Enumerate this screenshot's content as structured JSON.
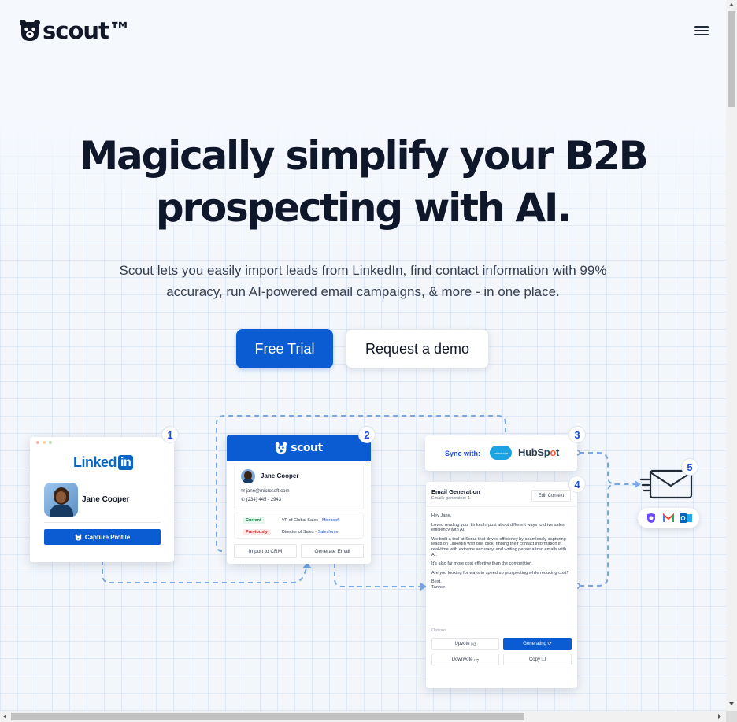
{
  "header": {
    "logo_text": "scout™",
    "logo_icon": "scout-bear-icon",
    "menu_icon": "hamburger-menu-icon"
  },
  "hero": {
    "headline_line1": "Magically simplify your B2B",
    "headline_line2": "prospecting with AI.",
    "subtext_line1": "Scout lets you easily import leads from LinkedIn, find contact information with 99%",
    "subtext_line2": "accuracy, run AI-powered email campaigns, & more - in one place.",
    "primary_cta": "Free Trial",
    "secondary_cta": "Request a demo"
  },
  "colors": {
    "brand_blue": "#0b5bd3",
    "linkedin_blue": "#0a66c2",
    "hubspot_orange": "#ff5c35",
    "salesforce_blue": "#1da1e1"
  },
  "flow": {
    "steps": [
      "1",
      "2",
      "3",
      "4",
      "5"
    ],
    "linkedin_card": {
      "brand_left": "Linked",
      "brand_right": "in",
      "profile_name": "Jane Cooper",
      "capture_button": "Capture Profile"
    },
    "scout_card": {
      "brand": "scout",
      "profile_name": "Jane Cooper",
      "email": "jane@microsoft.com",
      "phone": "(234) 445 - 2943",
      "current_label": "Current",
      "current_role": "VP of Global Sales - ",
      "current_company": "Microsoft",
      "previous_label": "Previously",
      "previous_role": "Director of Sales - ",
      "previous_company": "Salesforce",
      "import_button": "Import to CRM",
      "generate_button": "Generate Email"
    },
    "sync_card": {
      "label": "Sync with:",
      "salesforce": "salesforce",
      "hubspot_left": "HubSp",
      "hubspot_o": "o",
      "hubspot_right": "t"
    },
    "email_card": {
      "title": "Email Generation",
      "subtitle": "Emails generated: 1",
      "edit_button": "Edit Context",
      "greeting": "Hey Jane,",
      "p1": "Loved reading your LinkedIn post about different ways to drive sales efficiency with AI.",
      "p2": "We built a tool at Scout that drives efficiency by seamlessly capturing leads on LinkedIn with one click, finding their contact information in real-time with extreme accuracy, and writing personalized emails with AI.",
      "p3": "It's also far more cost effective than the competition.",
      "p4": "Are you looking for ways to speed up prospecting while reducing cost?",
      "signoff": "Best,",
      "signature": "Tanner",
      "options_label": "Options",
      "upvote": "Upvote",
      "generating": "Generating",
      "downvote": "Downvote",
      "copy": "Copy"
    },
    "mail_clients": [
      "proton-mail-icon",
      "gmail-icon",
      "outlook-icon"
    ]
  }
}
